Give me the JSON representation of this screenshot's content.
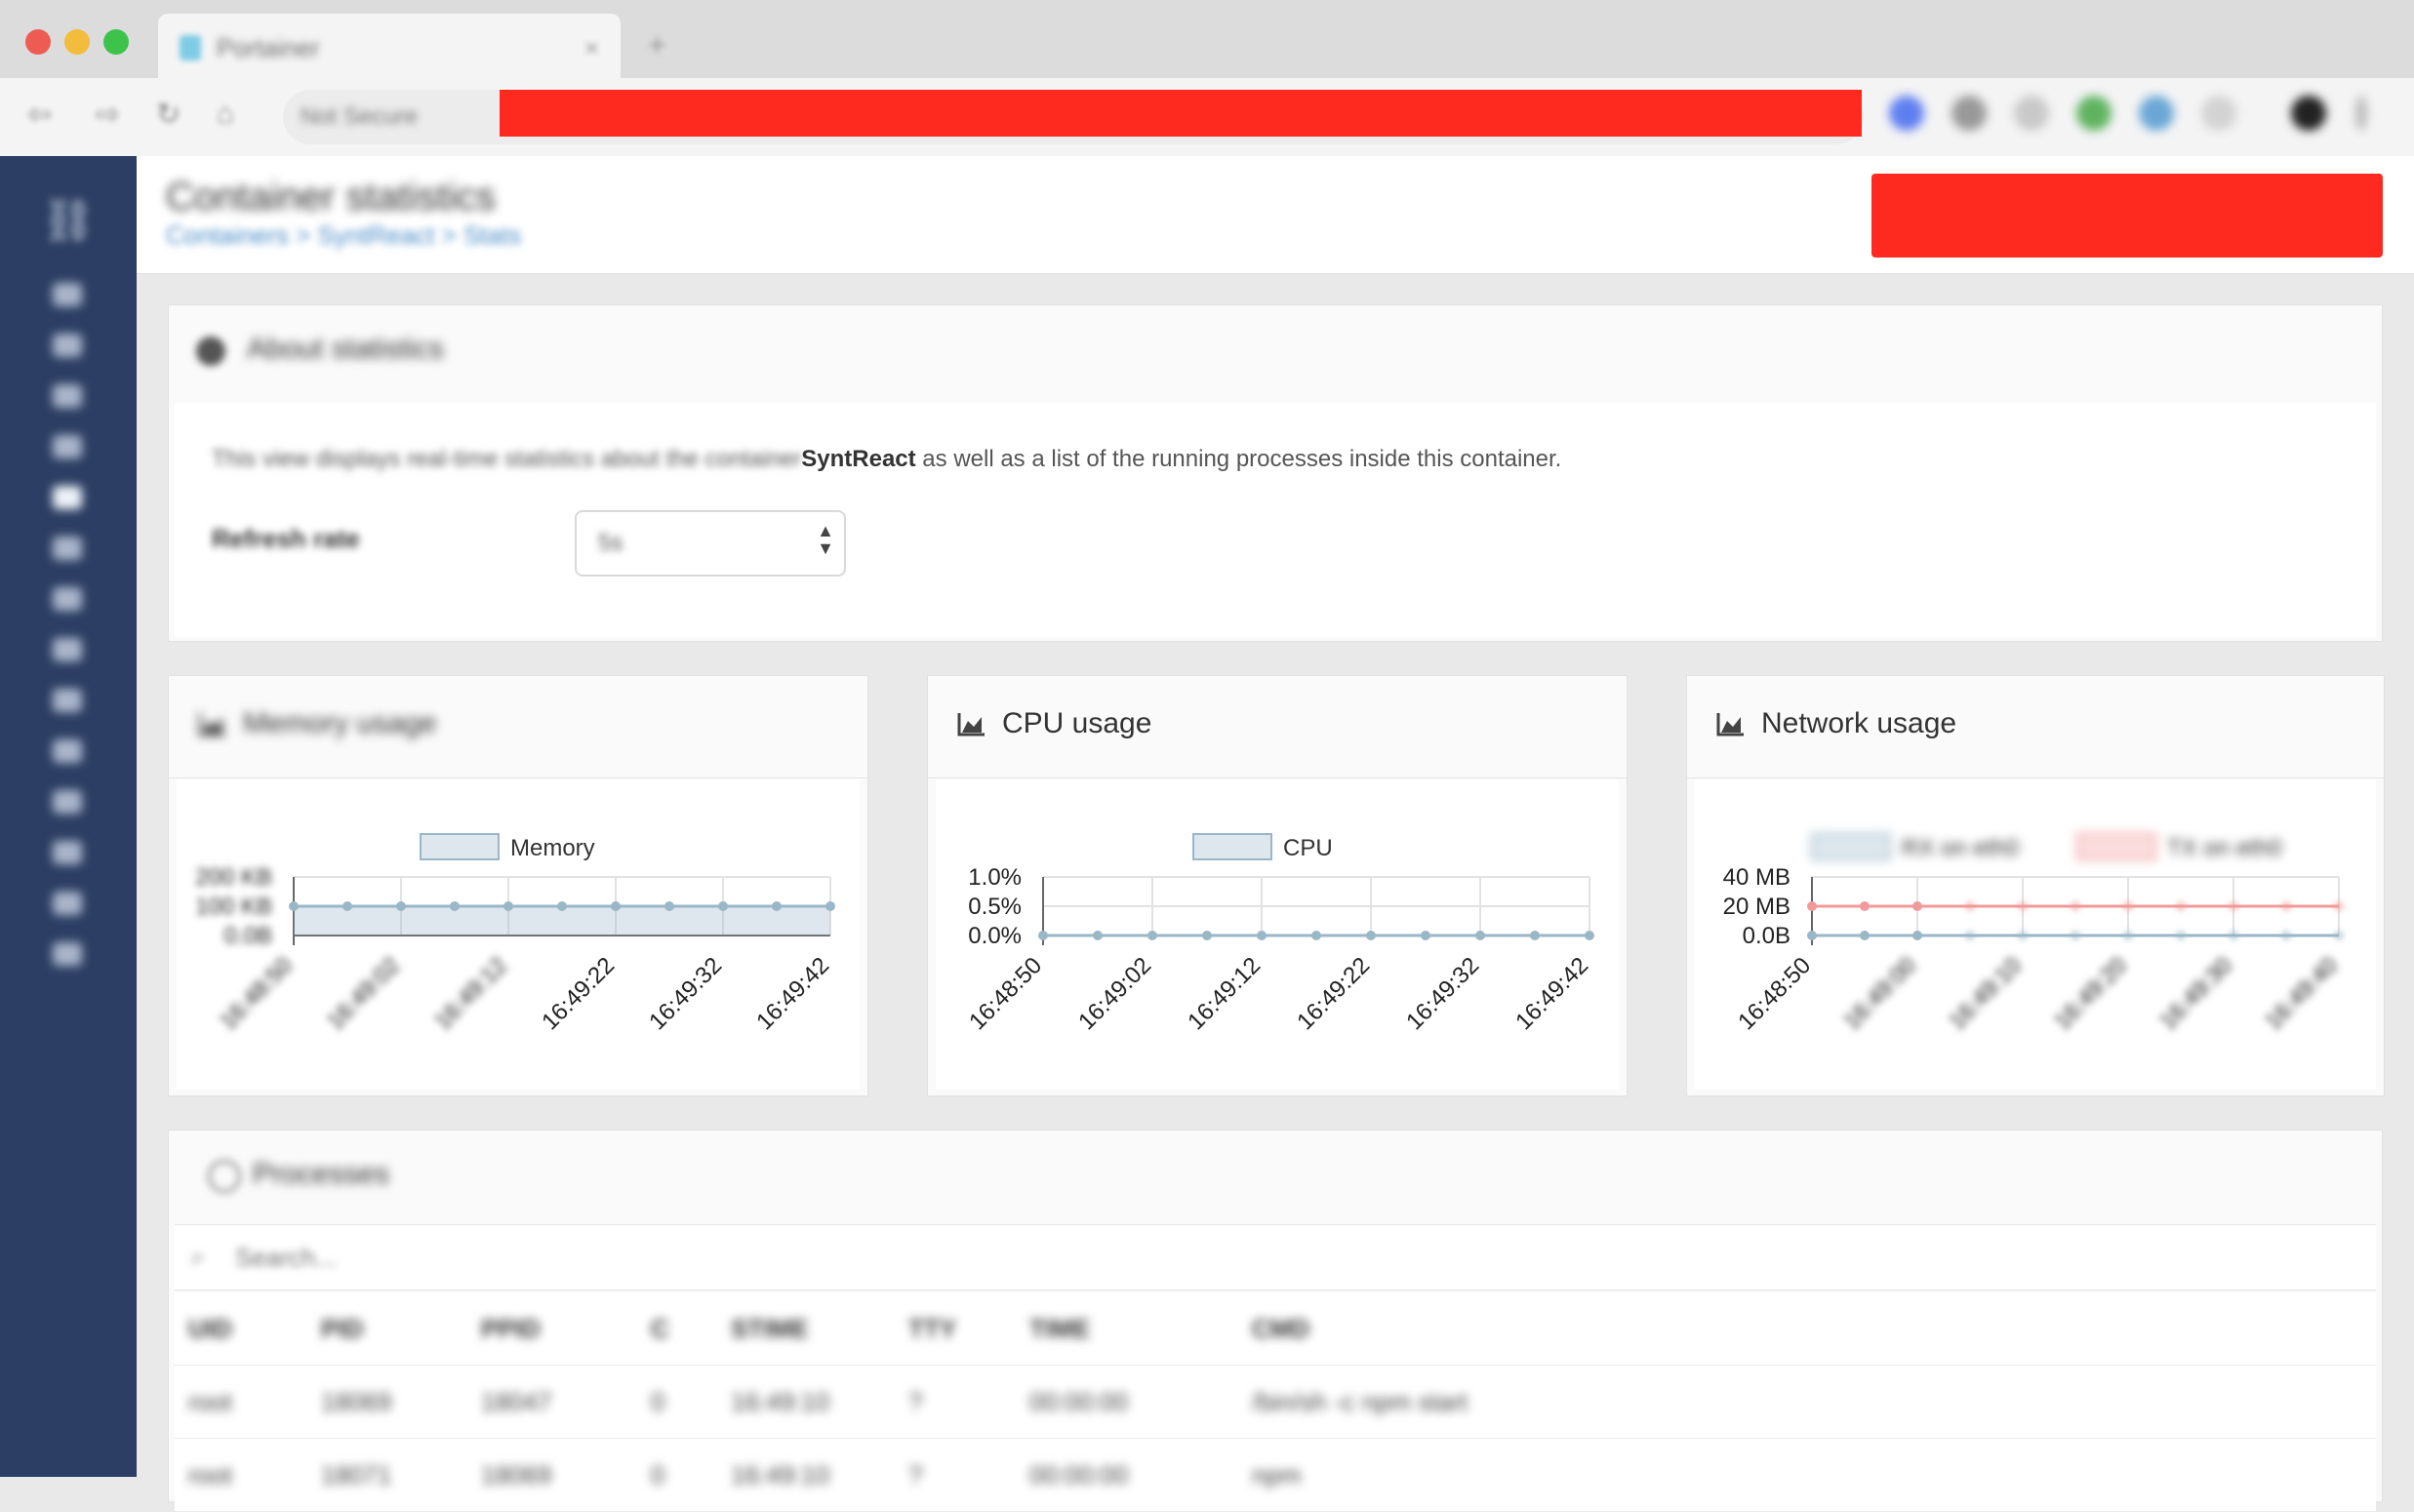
{
  "browser": {
    "tab_title": "Portainer",
    "tab_close": "×",
    "new_tab": "+",
    "url_security": "Not Secure"
  },
  "page": {
    "title": "Container statistics",
    "breadcrumb": "Containers > SyntReact > Stats"
  },
  "about": {
    "title": "About statistics",
    "desc_before": "This view displays real-time statistics about the container ",
    "container": "SyntReact",
    "desc_after": " as well as a list of the running processes inside this container.",
    "refresh_label": "Refresh rate",
    "refresh_value": "5s"
  },
  "charts": {
    "memory": {
      "title": "Memory usage"
    },
    "cpu": {
      "title": "CPU usage"
    },
    "network": {
      "title": "Network usage"
    }
  },
  "chart_data": [
    {
      "type": "area",
      "x": [
        "16:48:50",
        "16:48:56",
        "16:49:02",
        "16:49:07",
        "16:49:12",
        "16:49:17",
        "16:49:22",
        "16:49:27",
        "16:49:32",
        "16:49:37",
        "16:49:42"
      ],
      "x_tick_labels": [
        "16:48:50",
        "16:49:02",
        "16:49:12",
        "16:49:22",
        "16:49:32",
        "16:49:42"
      ],
      "series": [
        {
          "name": "Memory",
          "values": [
            0.5,
            0.5,
            0.5,
            0.5,
            0.5,
            0.5,
            0.5,
            0.5,
            0.5,
            0.5,
            0.5
          ]
        }
      ],
      "y_tick_labels": [
        "0.0B",
        "100 KB",
        "200 KB"
      ],
      "ylim": [
        0,
        1
      ],
      "color": "#9ab7c8",
      "grid": true,
      "legend": "top"
    },
    {
      "type": "area",
      "x": [
        "16:48:50",
        "16:48:56",
        "16:49:02",
        "16:49:07",
        "16:49:12",
        "16:49:17",
        "16:49:22",
        "16:49:27",
        "16:49:32",
        "16:49:37",
        "16:49:42"
      ],
      "x_tick_labels": [
        "16:48:50",
        "16:49:02",
        "16:49:12",
        "16:49:22",
        "16:49:32",
        "16:49:42"
      ],
      "series": [
        {
          "name": "CPU",
          "values": [
            0,
            0,
            0,
            0,
            0,
            0,
            0,
            0,
            0,
            0,
            0
          ]
        }
      ],
      "y_tick_labels": [
        "0.0%",
        "0.5%",
        "1.0%"
      ],
      "ylim": [
        0,
        1
      ],
      "color": "#9ab7c8",
      "grid": true,
      "legend": "top"
    },
    {
      "type": "line",
      "x": [
        "16:48:50",
        "16:48:55",
        "16:49:00",
        "16:49:05",
        "16:49:10",
        "16:49:15",
        "16:49:20",
        "16:49:25",
        "16:49:30",
        "16:49:35",
        "16:49:40"
      ],
      "x_tick_labels": [
        "16:48:50",
        "16:49:00",
        "16:49:10",
        "16:49:20",
        "16:49:30",
        "16:49:40"
      ],
      "series": [
        {
          "name": "RX on eth0",
          "values": [
            0,
            0,
            0,
            0,
            0,
            0,
            0,
            0,
            0,
            0,
            0
          ],
          "color": "#9ab7c8"
        },
        {
          "name": "TX on eth0",
          "values": [
            20,
            20,
            20,
            20,
            20,
            20,
            20,
            20,
            20,
            20,
            20
          ],
          "color": "#f19a9a"
        }
      ],
      "y_tick_labels": [
        "0.0B",
        "20 MB",
        "40 MB"
      ],
      "ylim": [
        0,
        40
      ],
      "grid": true,
      "legend": "top"
    }
  ],
  "processes": {
    "title": "Processes",
    "search_placeholder": "Search...",
    "columns": [
      "UID",
      "PID",
      "PPID",
      "C",
      "STIME",
      "TTY",
      "TIME",
      "CMD"
    ],
    "rows": [
      [
        "root",
        "18069",
        "18047",
        "0",
        "16:49:10",
        "?",
        "00:00:00",
        "/bin/sh -c npm start"
      ],
      [
        "root",
        "18071",
        "18069",
        "0",
        "16:49:10",
        "?",
        "00:00:00",
        "npm"
      ]
    ]
  }
}
